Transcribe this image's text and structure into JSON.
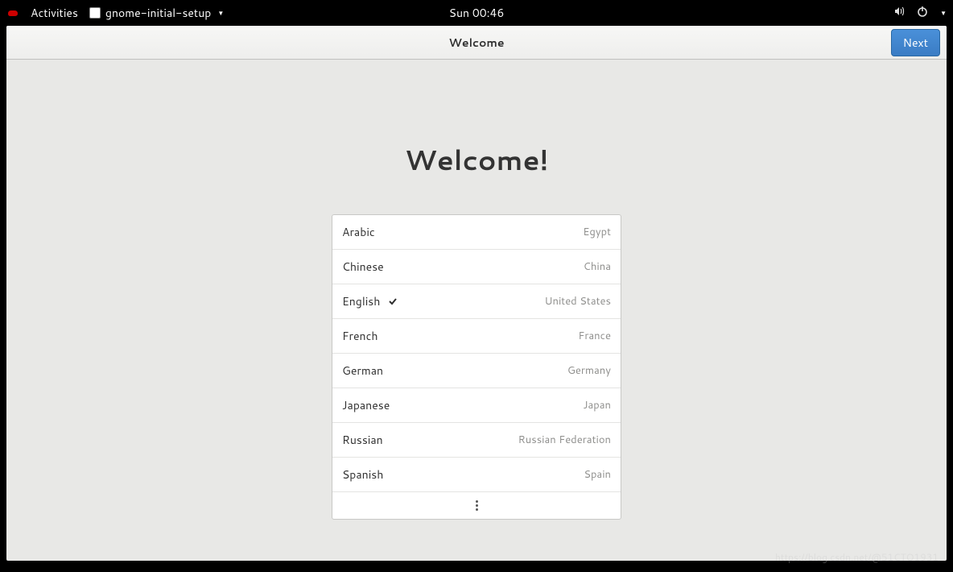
{
  "topbar": {
    "activities": "Activities",
    "app_name": "gnome-initial-setup",
    "clock": "Sun 00:46"
  },
  "header": {
    "title": "Welcome",
    "next": "Next"
  },
  "main": {
    "heading": "Welcome!"
  },
  "languages": [
    {
      "name": "Arabic",
      "region": "Egypt",
      "selected": false
    },
    {
      "name": "Chinese",
      "region": "China",
      "selected": false
    },
    {
      "name": "English",
      "region": "United States",
      "selected": true
    },
    {
      "name": "French",
      "region": "France",
      "selected": false
    },
    {
      "name": "German",
      "region": "Germany",
      "selected": false
    },
    {
      "name": "Japanese",
      "region": "Japan",
      "selected": false
    },
    {
      "name": "Russian",
      "region": "Russian Federation",
      "selected": false
    },
    {
      "name": "Spanish",
      "region": "Spain",
      "selected": false
    }
  ],
  "watermark": "https://blog.csdn.net/@51CTO1931"
}
